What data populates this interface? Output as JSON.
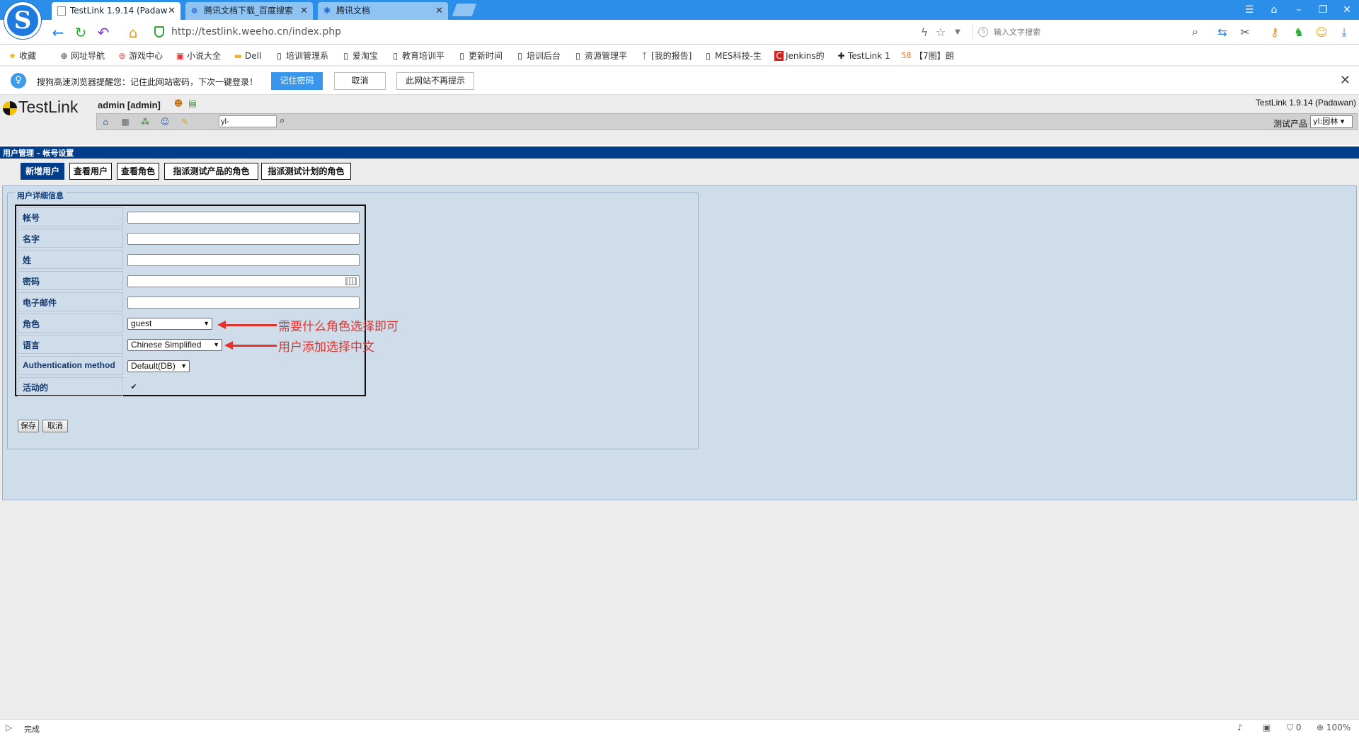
{
  "browser": {
    "tabs": [
      {
        "title": "TestLink 1.9.14 (Padaw",
        "active": true
      },
      {
        "title": "腾讯文档下载_百度搜索",
        "active": false
      },
      {
        "title": "腾讯文档",
        "active": false
      }
    ],
    "url_host": "http://testlink.weeho.cn/",
    "url_path": "index.php",
    "search_placeholder": "输入文字搜索",
    "bookmarks": [
      "收藏",
      "网址导航",
      "游戏中心",
      "小说大全",
      "Dell",
      "培训管理系",
      "爱淘宝",
      "教育培训平",
      "更新时间",
      "培训后台",
      "资源管理平",
      "[我的报告]",
      "MES科技-生",
      "Jenkins的",
      "TestLink 1",
      "【7图】朗"
    ]
  },
  "notify": {
    "text": "搜狗高速浏览器提醒您：记住此网站密码，下次一键登录！",
    "remember_label": "记住密码",
    "cancel_label": "取消",
    "never_label": "此网站不再提示"
  },
  "testlink": {
    "logo_text": "TestLink",
    "user": "admin [admin]",
    "version": "TestLink 1.9.14 (Padawan)",
    "search_value": "yl-",
    "product_label": "测试产品",
    "product_value": "yl:园林",
    "page_title": "用户管理 - 帐号设置",
    "subtabs": [
      "新增用户",
      "查看用户",
      "查看角色",
      "指派测试产品的角色",
      "指派测试计划的角色"
    ],
    "fieldset_legend": "用户详细信息",
    "fields": {
      "login": {
        "label": "帐号",
        "value": ""
      },
      "firstname": {
        "label": "名字",
        "value": ""
      },
      "lastname": {
        "label": "姓",
        "value": ""
      },
      "password": {
        "label": "密码",
        "value": ""
      },
      "email": {
        "label": "电子邮件",
        "value": ""
      },
      "role": {
        "label": "角色",
        "value": "guest"
      },
      "locale": {
        "label": "语言",
        "value": "Chinese Simplified"
      },
      "auth": {
        "label": "Authentication method",
        "value": "Default(DB)"
      },
      "active": {
        "label": "活动的",
        "checked": true
      }
    },
    "save_label": "保存",
    "cancel_label": "取消"
  },
  "annotations": {
    "role_note": "需要什么角色选择即可",
    "locale_note": "用户添加选择中文"
  },
  "status": {
    "text": "完成",
    "count": "0",
    "zoom": "100%"
  },
  "colors": {
    "tab_bar": "#2b8ee8",
    "tl_blue": "#003e8b",
    "content_bg": "#cfdcea",
    "annotation": "#e2332d"
  }
}
